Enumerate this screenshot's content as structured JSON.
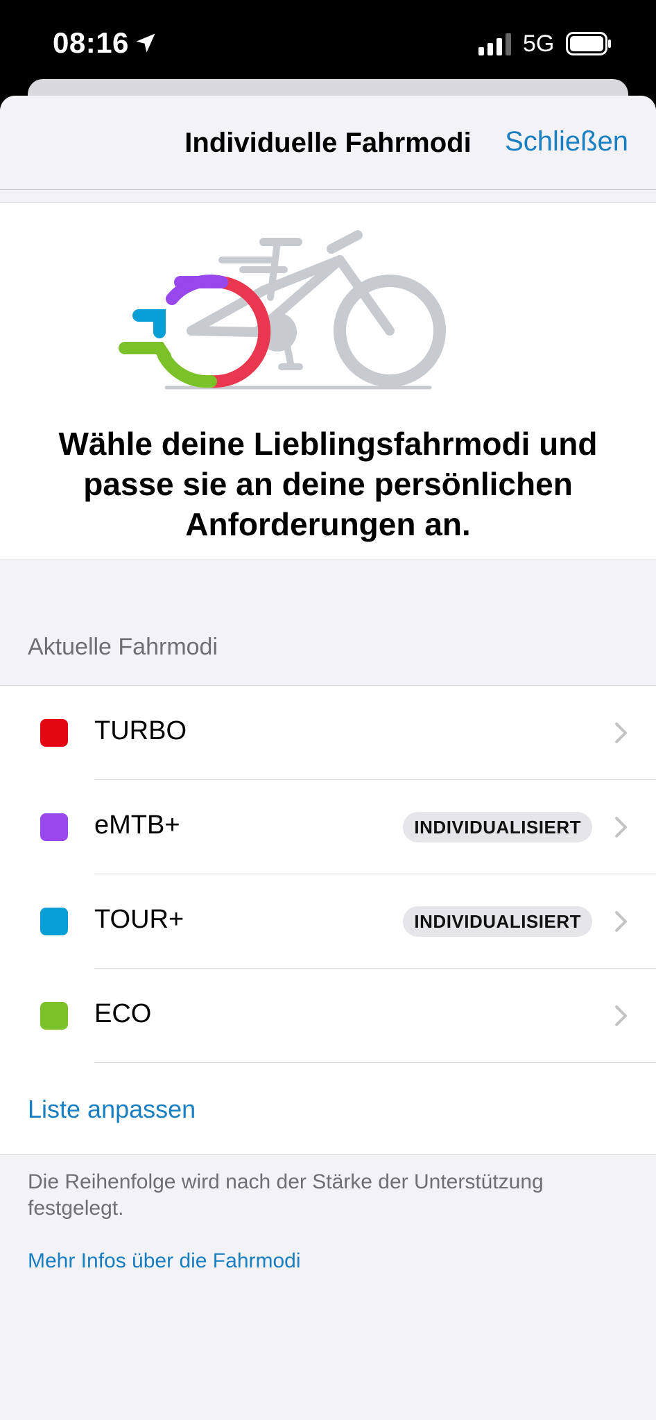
{
  "status_bar": {
    "time": "08:16",
    "network": "5G",
    "icons": [
      "location-arrow-icon",
      "cellular-signal-icon",
      "battery-icon"
    ]
  },
  "nav": {
    "title": "Individuelle Fahrmodi",
    "close_label": "Schließen"
  },
  "hero": {
    "illustration": "bike-icon",
    "text": "Wähle deine Lieblingsfahrmodi und passe sie an deine persönlichen Anforderungen an."
  },
  "section": {
    "header": "Aktuelle Fahrmodi"
  },
  "modes": [
    {
      "label": "TURBO",
      "color": "#e30613",
      "badge": ""
    },
    {
      "label": "eMTB+",
      "color": "#9747ec",
      "badge": "INDIVIDUALISIERT"
    },
    {
      "label": "TOUR+",
      "color": "#079fd6",
      "badge": "INDIVIDUALISIERT"
    },
    {
      "label": "ECO",
      "color": "#7ac12a",
      "badge": ""
    }
  ],
  "customize_link": "Liste anpassen",
  "footer": {
    "note": "Die Reihenfolge wird nach der Stärke der Unterstützung festgelegt.",
    "more_info": "Mehr Infos über die Fahrmodi"
  },
  "colors": {
    "accent": "#1a7fc1",
    "background": "#f2f2f7"
  }
}
